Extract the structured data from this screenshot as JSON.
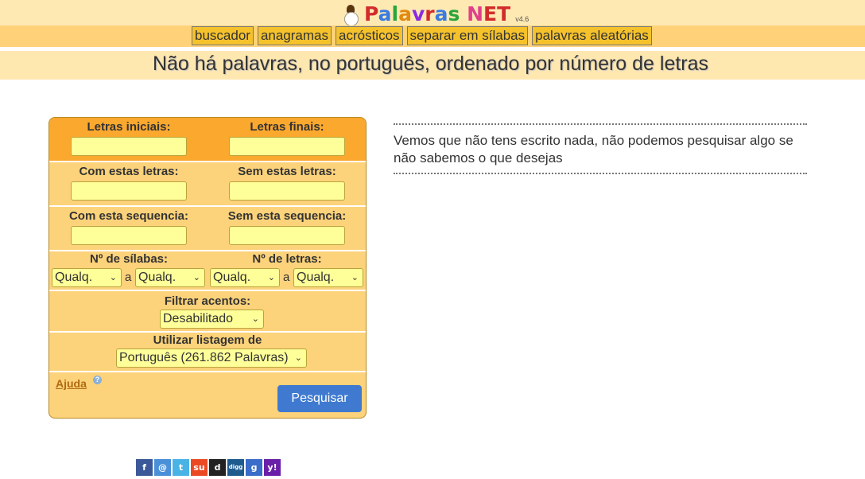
{
  "logo": {
    "letters": [
      {
        "ch": "P",
        "color": "#d22b2b"
      },
      {
        "ch": "a",
        "color": "#3a7be0"
      },
      {
        "ch": "l",
        "color": "#2aa53a"
      },
      {
        "ch": "a",
        "color": "#e08a10"
      },
      {
        "ch": "v",
        "color": "#8a2be2"
      },
      {
        "ch": "r",
        "color": "#d22b2b"
      },
      {
        "ch": "a",
        "color": "#3a7be0"
      },
      {
        "ch": "s",
        "color": "#2aa53a"
      },
      {
        "ch": " ",
        "color": "#000"
      },
      {
        "ch": "N",
        "color": "#e0408a"
      },
      {
        "ch": "E",
        "color": "#d22b2b"
      },
      {
        "ch": "T",
        "color": "#d22b2b"
      }
    ],
    "version": "v4.6"
  },
  "nav": [
    {
      "label": "buscador",
      "name": "nav-buscador"
    },
    {
      "label": "anagramas",
      "name": "nav-anagramas"
    },
    {
      "label": "acrósticos",
      "name": "nav-acrosticos"
    },
    {
      "label": "separar em sílabas",
      "name": "nav-separar-silabas"
    },
    {
      "label": "palavras aleatórias",
      "name": "nav-palavras-aleatorias"
    }
  ],
  "headline": "Não há palavras, no português, ordenado por número de letras",
  "form": {
    "initial_letters_label": "Letras iniciais:",
    "final_letters_label": "Letras finais:",
    "with_letters_label": "Com estas letras:",
    "without_letters_label": "Sem estas letras:",
    "with_sequence_label": "Com esta sequencia:",
    "without_sequence_label": "Sem esta sequencia:",
    "syllables_label": "Nº de sílabas:",
    "letters_label": "Nº de letras:",
    "range_sep": "a",
    "any_option": "Qualq.",
    "accents_label": "Filtrar acentos:",
    "accents_value": "Desabilitado",
    "list_label": "Utilizar listagem de",
    "list_value": "Português (261.862 Palavras)",
    "help": "Ajuda",
    "help_mark": "?",
    "search_button": "Pesquisar"
  },
  "message": "Vemos que não tens escrito nada, não podemos pesquisar algo se não sabemos o que desejas",
  "social": [
    {
      "icon": "facebook-icon",
      "glyph": "f",
      "color": "#3b5998"
    },
    {
      "icon": "email-icon",
      "glyph": "@",
      "color": "#4a90d9"
    },
    {
      "icon": "twitter-icon",
      "glyph": "t",
      "color": "#4ab3e6"
    },
    {
      "icon": "stumbleupon-icon",
      "glyph": "su",
      "color": "#eb4924"
    },
    {
      "icon": "delicious-icon",
      "glyph": "d",
      "color": "#222222"
    },
    {
      "icon": "digg-icon",
      "glyph": "digg",
      "color": "#1d5b8f"
    },
    {
      "icon": "google-icon",
      "glyph": "g",
      "color": "#3a6cc9"
    },
    {
      "icon": "yahoo-icon",
      "glyph": "y!",
      "color": "#6a1fa8"
    }
  ]
}
